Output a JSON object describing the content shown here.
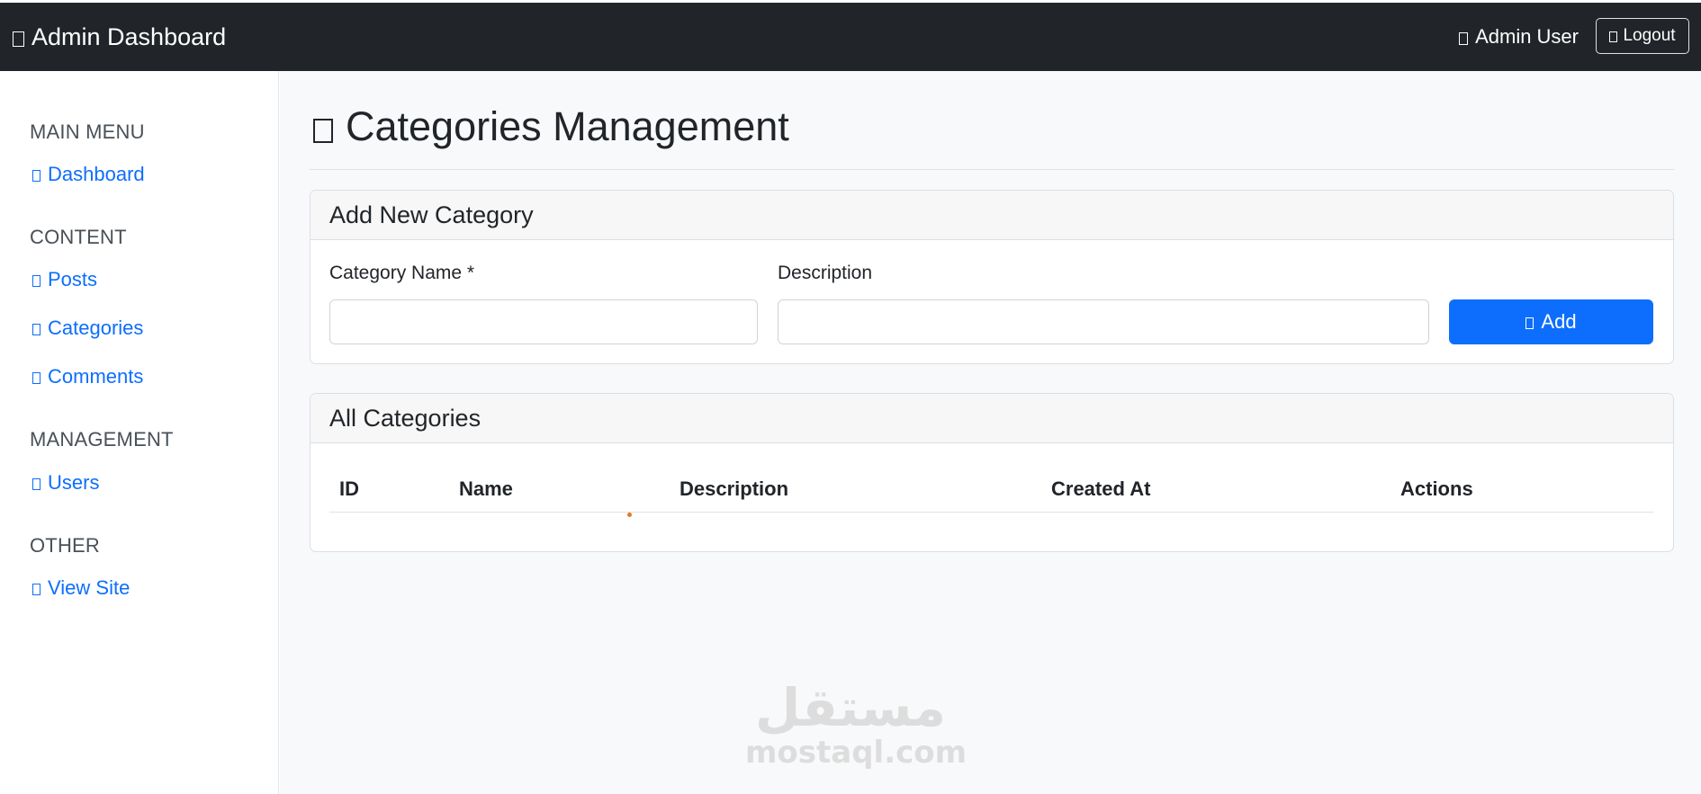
{
  "navbar": {
    "brand": "Admin Dashboard",
    "brand_icon": "speedometer-icon",
    "user": "Admin User",
    "user_icon": "person-icon",
    "logout_label": "Logout",
    "logout_icon": "logout-icon",
    "background": "#212529"
  },
  "sidebar": {
    "sections": [
      {
        "heading": "MAIN MENU",
        "items": [
          {
            "label": "Dashboard",
            "icon": "speedometer-icon"
          }
        ]
      },
      {
        "heading": "CONTENT",
        "items": [
          {
            "label": "Posts",
            "icon": "file-text-icon"
          },
          {
            "label": "Categories",
            "icon": "tags-icon"
          },
          {
            "label": "Comments",
            "icon": "chat-icon"
          }
        ]
      },
      {
        "heading": "MANAGEMENT",
        "items": [
          {
            "label": "Users",
            "icon": "people-icon"
          }
        ]
      },
      {
        "heading": "OTHER",
        "items": [
          {
            "label": "View Site",
            "icon": "globe-icon"
          }
        ]
      }
    ],
    "link_color": "#0d6efd"
  },
  "page": {
    "title": "Categories Management",
    "title_icon": "tags-icon"
  },
  "add_form": {
    "header": "Add New Category",
    "name_label": "Category Name *",
    "name_value": "",
    "description_label": "Description",
    "description_value": "",
    "submit_label": "Add",
    "submit_icon": "plus-icon",
    "accent": "#0d6efd"
  },
  "categories_table": {
    "header": "All Categories",
    "columns": [
      "ID",
      "Name",
      "Description",
      "Created At",
      "Actions"
    ],
    "rows": []
  },
  "watermark": {
    "arabic": "مستقل",
    "latin": "mostaql.com"
  }
}
